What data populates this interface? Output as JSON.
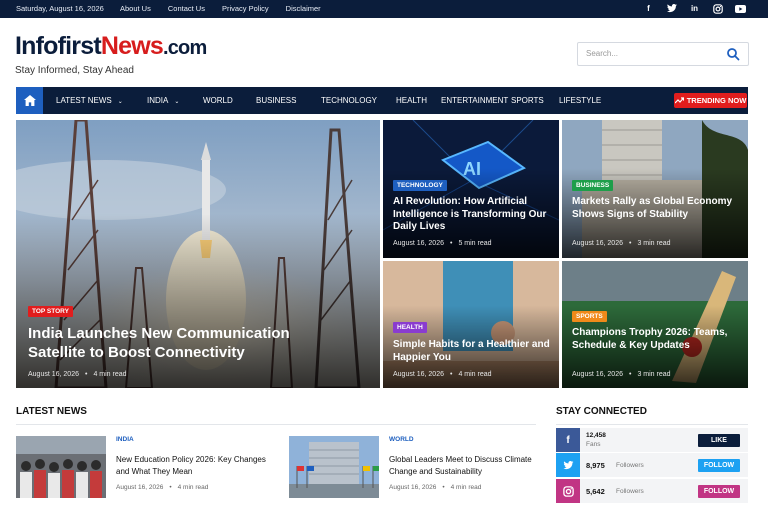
{
  "topbar": {
    "date": "Saturday, August 16, 2026",
    "links": [
      "About Us",
      "Contact Us",
      "Privacy Policy",
      "Disclaimer"
    ],
    "social_icons": [
      "facebook-icon",
      "twitter-icon",
      "linkedin-icon",
      "instagram-icon",
      "youtube-icon"
    ]
  },
  "header": {
    "logo": {
      "part1": "Infofirst",
      "part2": "News",
      "part3": ".com"
    },
    "tagline": "Stay Informed, Stay Ahead",
    "search_placeholder": "Search..."
  },
  "nav": {
    "items": [
      {
        "label": "LATEST NEWS",
        "dropdown": true
      },
      {
        "label": "INDIA",
        "dropdown": true
      },
      {
        "label": "WORLD",
        "dropdown": false
      },
      {
        "label": "BUSINESS",
        "dropdown": false
      },
      {
        "label": "TECHNOLOGY",
        "dropdown": false
      },
      {
        "label": "HEALTH",
        "dropdown": false
      },
      {
        "label": "ENTERTAINMENT",
        "dropdown": false
      },
      {
        "label": "SPORTS",
        "dropdown": false
      },
      {
        "label": "LIFESTYLE",
        "dropdown": false
      }
    ],
    "trending": "TRENDING NOW"
  },
  "featured": {
    "main": {
      "badge": "TOP STORY",
      "title": "India Launches New Communication Satellite to Boost Connectivity",
      "date": "August 16, 2026",
      "read": "4 min read"
    },
    "tech": {
      "badge": "TECHNOLOGY",
      "title": "AI Revolution: How Artificial Intelligence is Transforming Our Daily Lives",
      "date": "August 16, 2026",
      "read": "5 min read",
      "chip_text": "AI"
    },
    "business": {
      "badge": "BUSINESS",
      "title": "Markets Rally as Global Economy Shows Signs of Stability",
      "date": "August 16, 2026",
      "read": "3 min read"
    },
    "health": {
      "badge": "HEALTH",
      "title": "Simple Habits for a Healthier and Happier You",
      "date": "August 16, 2026",
      "read": "4 min read"
    },
    "sports": {
      "badge": "SPORTS",
      "title": "Champions Trophy 2026: Teams, Schedule & Key Updates",
      "date": "August 16, 2026",
      "read": "3 min read"
    }
  },
  "latest": {
    "title": "LATEST NEWS",
    "items": [
      {
        "cat": "INDIA",
        "title": "New Education Policy 2026: Key Changes and What They Mean",
        "date": "August 16, 2026",
        "read": "4 min read"
      },
      {
        "cat": "WORLD",
        "title": "Global Leaders Meet to Discuss Climate Change and Sustainability",
        "date": "August 16, 2026",
        "read": "4 min read"
      }
    ]
  },
  "connected": {
    "title": "STAY CONNECTED",
    "rows": [
      {
        "network": "facebook",
        "count": "12,458",
        "label": "Fans",
        "button": "LIKE",
        "color": "#3b5998"
      },
      {
        "network": "twitter",
        "count": "8,975",
        "label": "Followers",
        "button": "FOLLOW",
        "color": "#1da1f2"
      },
      {
        "network": "instagram",
        "count": "5,642",
        "label": "Followers",
        "button": "FOLLOW",
        "color": "#c13584"
      }
    ]
  },
  "colors": {
    "navy": "#0b1d3b",
    "brand_red": "#d71d1d",
    "accent_blue": "#1e5fbf"
  }
}
